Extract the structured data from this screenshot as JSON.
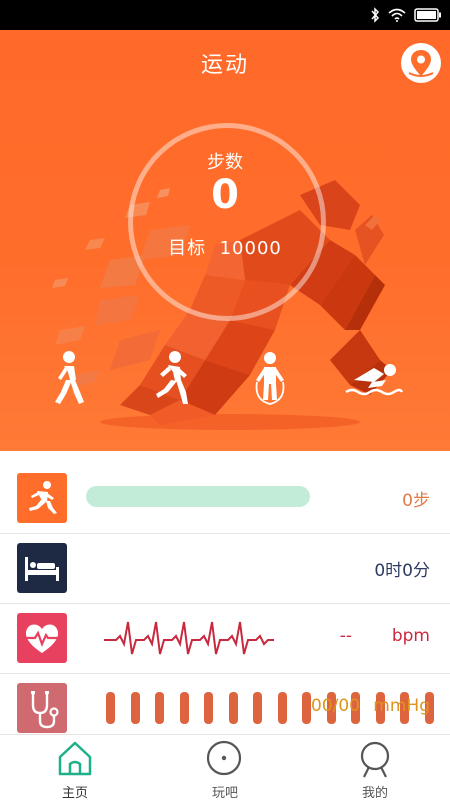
{
  "header": {
    "title": "运动"
  },
  "steps": {
    "label": "步数",
    "value": "0",
    "goal_label": "目标",
    "goal_value": "10000"
  },
  "modes": [
    {
      "icon": "walk-icon"
    },
    {
      "icon": "run-icon"
    },
    {
      "icon": "jump-rope-icon"
    },
    {
      "icon": "swim-icon"
    }
  ],
  "rows": {
    "steps": {
      "icon": "running-person-icon",
      "value": "0步",
      "progress": 0,
      "icon_bg": "#ff6d2b",
      "color": "#e27a48"
    },
    "sleep": {
      "icon": "bed-icon",
      "value": "0时0分",
      "icon_bg": "#1e2a44",
      "color": "#2d3b63"
    },
    "heart": {
      "icon": "heart-pulse-icon",
      "value": "--",
      "unit": "bpm",
      "icon_bg": "#e8405f",
      "color": "#c9293f"
    },
    "blood_pressure": {
      "icon": "stethoscope-icon",
      "value": "00/00",
      "unit": "mmHg",
      "icon_bg": "#cf6a70",
      "color": "#e0931c"
    }
  },
  "tabs": [
    {
      "label": "主页",
      "icon": "home-icon",
      "active": true
    },
    {
      "label": "玩吧",
      "icon": "play-circle-icon",
      "active": false
    },
    {
      "label": "我的",
      "icon": "profile-icon",
      "active": false
    }
  ],
  "colors": {
    "accent": "#ff6d2b",
    "tab_active": "#1fb08a",
    "tab_inactive": "#555555"
  }
}
